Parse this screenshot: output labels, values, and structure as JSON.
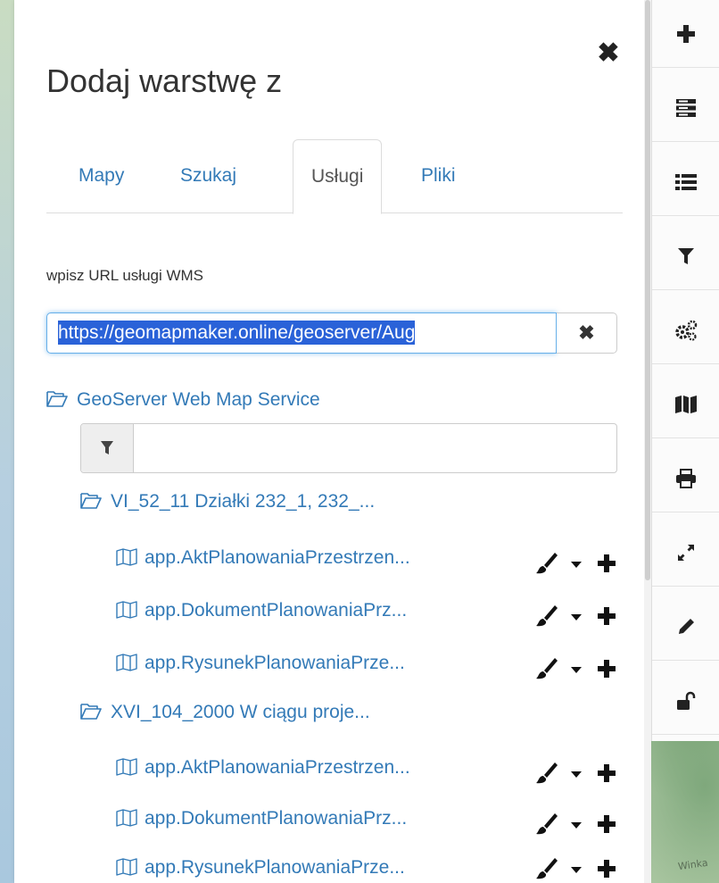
{
  "dialog": {
    "title": "Dodaj warstwę z",
    "close_symbol": "✖",
    "tabs": [
      {
        "label": "Mapy",
        "active": false
      },
      {
        "label": "Szukaj",
        "active": false
      },
      {
        "label": "Usługi",
        "active": true
      },
      {
        "label": "Pliki",
        "active": false
      }
    ]
  },
  "service": {
    "url_label": "wpisz URL usługi WMS",
    "url_value": "https://geomapmaker.online/geoserver/Aug",
    "clear_symbol": "✖"
  },
  "tree": {
    "root": "GeoServer Web Map Service",
    "filter_value": "",
    "groups": [
      {
        "label": "VI_52_11 Działki 232_1, 232_...",
        "layers": [
          "app.AktPlanowaniaPrzestrzen...",
          "app.DokumentPlanowaniaPrz...",
          "app.RysunekPlanowaniaPrze..."
        ]
      },
      {
        "label": "XVI_104_2000 W ciągu proje...",
        "layers": [
          "app.AktPlanowaniaPrzestrzen...",
          "app.DokumentPlanowaniaPrz...",
          "app.RysunekPlanowaniaPrze..."
        ]
      }
    ]
  },
  "map": {
    "partial_label": "Winka"
  },
  "toolbar": {
    "icons": [
      "plus-icon",
      "layers-stack-icon",
      "list-icon",
      "filter-icon",
      "cogs-icon",
      "map-icon",
      "print-icon",
      "expand-icon",
      "pencil-icon",
      "unlock-icon"
    ]
  },
  "colors": {
    "link": "#337ab7",
    "selection": "#2a62d8"
  }
}
